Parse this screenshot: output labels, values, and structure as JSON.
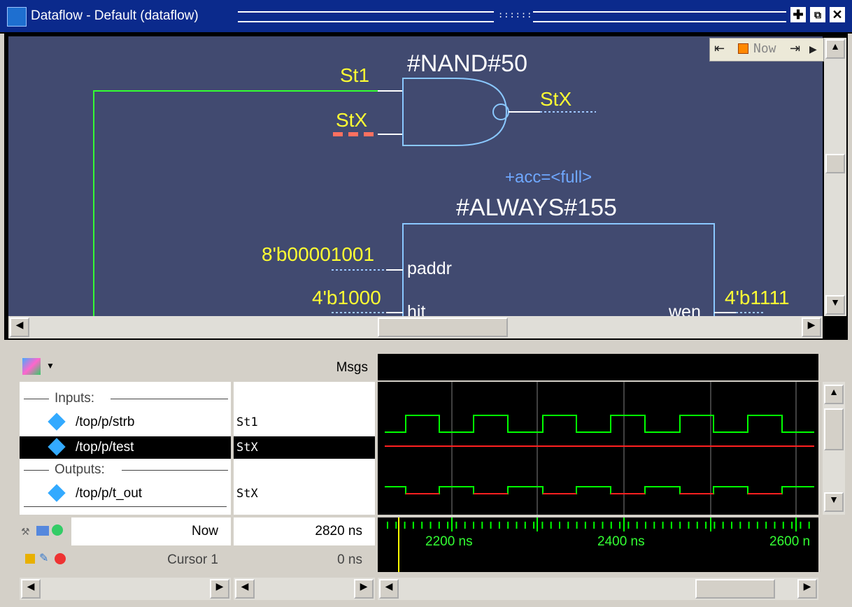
{
  "window": {
    "title": "Dataflow - Default (dataflow)",
    "title_icon": "dataflow-app-icon",
    "buttons": [
      "maximize-icon",
      "undock-icon",
      "close-icon"
    ]
  },
  "dataflow": {
    "toolbar": {
      "now_label": "Now",
      "icons": [
        "trace-back-icon",
        "now-marker-icon",
        "trace-forward-icon",
        "expand-arrow-icon"
      ]
    },
    "nand": {
      "name": "#NAND#50",
      "input_a_value": "St1",
      "input_b_value": "StX",
      "output_value": "StX"
    },
    "always": {
      "acc_label": "+acc=<full>",
      "name": "#ALWAYS#155",
      "port_paddr": "paddr",
      "port_hit": "hit",
      "port_wen": "wen",
      "paddr_value": "8'b00001001",
      "hit_value": "4'b1000",
      "wen_value": "4'b1111"
    }
  },
  "wave": {
    "header_icon": "wave-group-icon",
    "msgs_label": "Msgs",
    "groups": {
      "inputs_label": "Inputs:",
      "outputs_label": "Outputs:"
    },
    "signals": [
      {
        "name": "/top/p/strb",
        "value": "St1",
        "icon": "input-signal-icon",
        "selected": false
      },
      {
        "name": "/top/p/test",
        "value": "StX",
        "icon": "signal-icon",
        "selected": true
      },
      {
        "name": "/top/p/t_out",
        "value": "StX",
        "icon": "output-signal-icon",
        "selected": false
      }
    ],
    "footer": {
      "now_label": "Now",
      "now_value": "2820 ns",
      "cursor_label": "Cursor 1",
      "cursor_value": "0 ns"
    },
    "timeline": {
      "ticks": [
        "2200 ns",
        "2400 ns",
        "2600 n"
      ]
    },
    "colors": {
      "high": "#00ff00",
      "unknown": "#ff2020",
      "grid": "#808080"
    }
  }
}
